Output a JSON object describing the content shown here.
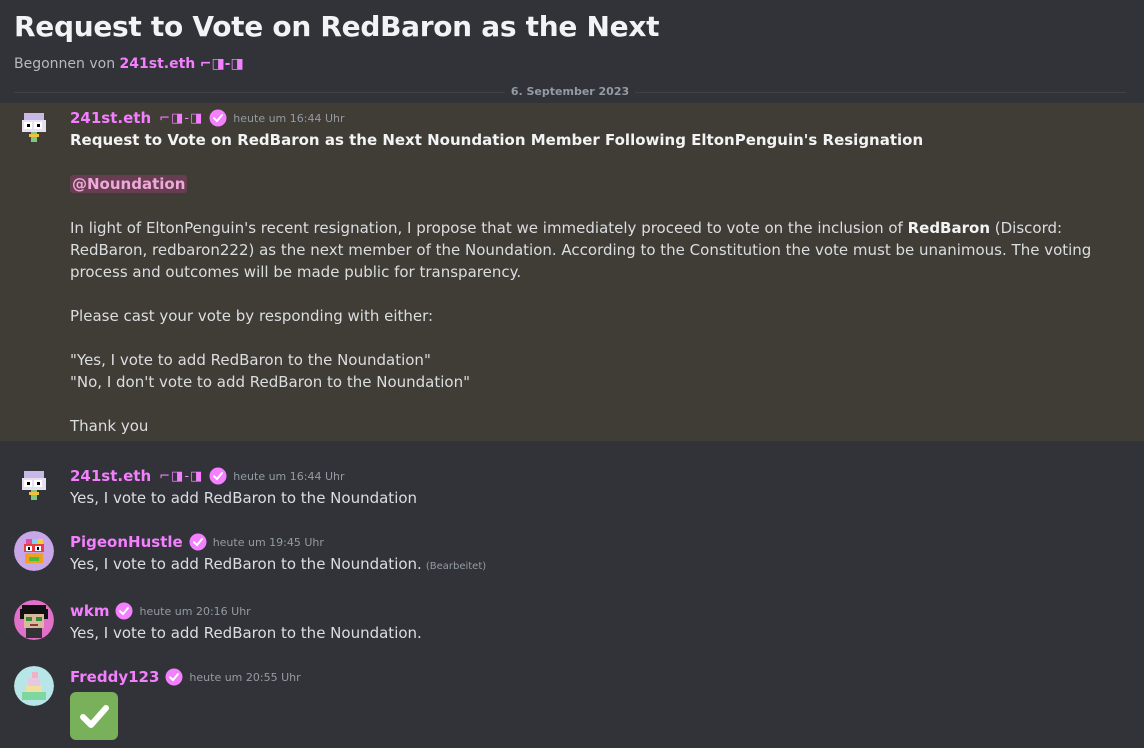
{
  "thread": {
    "title": "Request to Vote on RedBaron as the Next",
    "started_by_prefix": "Begonnen von",
    "started_by_author": "241st.eth",
    "started_by_tag": "⌐◨-◨",
    "date_divider": "6. September 2023"
  },
  "colors": {
    "accent": "#f47fff",
    "background": "#313338",
    "highlight": "#403c36"
  },
  "messages": [
    {
      "username": "241st.eth",
      "tag": "⌐◨-◨",
      "time": "heute um 16:44 Uhr",
      "heading": "Request to Vote on RedBaron as the Next Noundation Member Following EltonPenguin's Resignation",
      "mention": "@Noundation",
      "para1_a": "In light of EltonPenguin's recent resignation, I propose that we immediately proceed to vote on the inclusion of",
      "para1_bold": "RedBaron",
      "para1_b": " (Discord: RedBaron, redbaron222) as the next member of the Noundation. According to the Constitution the vote must be unanimous. The voting process and outcomes will be made public for transparency.",
      "para2": "Please cast your vote by responding with either:",
      "option_yes": "\"Yes, I vote to add RedBaron to the Noundation\"",
      "option_no": "\"No, I don't vote to add RedBaron to the Noundation\"",
      "closing": "Thank you"
    },
    {
      "username": "241st.eth",
      "tag": "⌐◨-◨",
      "time": "heute um 16:44 Uhr",
      "text": "Yes, I vote to add RedBaron to the Noundation"
    },
    {
      "username": "PigeonHustle",
      "time": "heute um 19:45 Uhr",
      "text": "Yes, I vote to add RedBaron to the Noundation.",
      "edited": "(Bearbeitet)"
    },
    {
      "username": "wkm",
      "time": "heute um 20:16 Uhr",
      "text": "Yes, I vote to add RedBaron to the Noundation."
    },
    {
      "username": "Freddy123",
      "time": "heute um 20:55 Uhr",
      "emoji": "check-mark-emoji"
    }
  ]
}
